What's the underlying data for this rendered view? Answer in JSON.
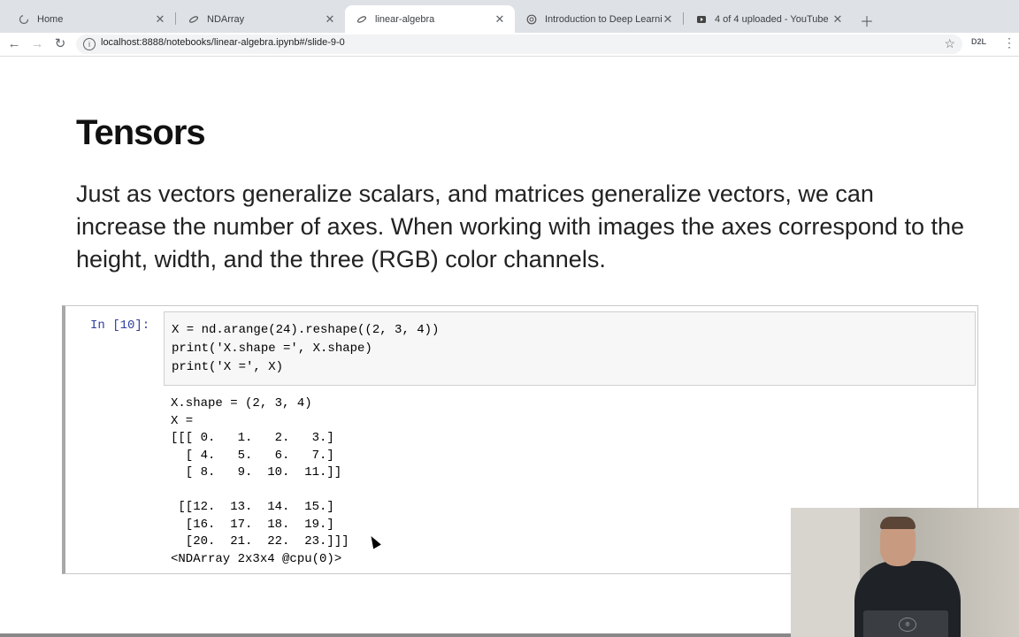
{
  "tabs": [
    {
      "title": "Home",
      "icon": "loading-spinner-icon"
    },
    {
      "title": "NDArray",
      "icon": "jupyter-icon"
    },
    {
      "title": "linear-algebra",
      "icon": "jupyter-icon"
    },
    {
      "title": "Introduction to Deep Learning",
      "icon": "openai-logo-icon"
    },
    {
      "title": "4 of 4 uploaded - YouTube",
      "icon": "youtube-studio-icon"
    }
  ],
  "address": {
    "url": "localhost:8888/notebooks/linear-algebra.ipynb#/slide-9-0"
  },
  "extension_label": "D2L",
  "slide": {
    "title": "Tensors",
    "paragraph": "Just as vectors generalize scalars, and matrices generalize vectors, we can increase the number of axes. When working with images the axes correspond to the height, width, and the three (RGB) color channels."
  },
  "cell": {
    "prompt": "In [10]:",
    "code_lines": [
      "X = nd.arange(24).reshape((2, 3, 4))",
      "print('X.shape =', X.shape)",
      "print('X =', X)"
    ],
    "output_lines": [
      "X.shape = (2, 3, 4)",
      "X =",
      "[[[ 0.   1.   2.   3.]",
      "  [ 4.   5.   6.   7.]",
      "  [ 8.   9.  10.  11.]]",
      "",
      " [[12.  13.  14.  15.]",
      "  [16.  17.  18.  19.]",
      "  [20.  21.  22.  23.]]]",
      "<NDArray 2x3x4 @cpu(0)>"
    ]
  }
}
